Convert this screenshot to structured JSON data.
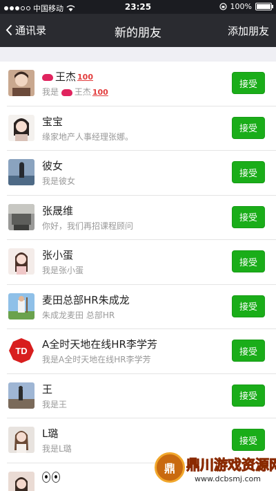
{
  "statusbar": {
    "carrier": "中国移动",
    "time": "23:25",
    "battery": "100%"
  },
  "navbar": {
    "back_label": "通讯录",
    "title": "新的朋友",
    "add_label": "添加朋友"
  },
  "requests": [
    {
      "name": "王杰",
      "message": "我是",
      "message_suffix": "王杰",
      "accept": "接受"
    },
    {
      "name": "宝宝",
      "message": "缘家地产人事经理张娜。",
      "accept": "接受"
    },
    {
      "name": "彼女",
      "message": "我是彼女",
      "accept": "接受"
    },
    {
      "name": "张晟维",
      "message": "你好，我们再招课程顾问",
      "accept": "接受"
    },
    {
      "name": "张小蛋",
      "message": "我是张小蛋",
      "accept": "接受"
    },
    {
      "name": "麦田总部HR朱成龙",
      "message": "朱成龙麦田 总部HR",
      "accept": "接受"
    },
    {
      "name": "A全时天地在线HR李学芳",
      "message": "我是A全时天地在线HR李学芳",
      "accept": "接受"
    },
    {
      "name": "王",
      "message": "我是王",
      "accept": "接受"
    },
    {
      "name": "L璐",
      "message": "我是L璐",
      "accept": "接受"
    }
  ],
  "watermark": {
    "logo_text": "鼎",
    "title": "鼎川游戏资源网",
    "url": "www.dcbsmj.com"
  },
  "colors": {
    "accent_green": "#1aad19",
    "navbar_bg": "#2a2b30"
  }
}
